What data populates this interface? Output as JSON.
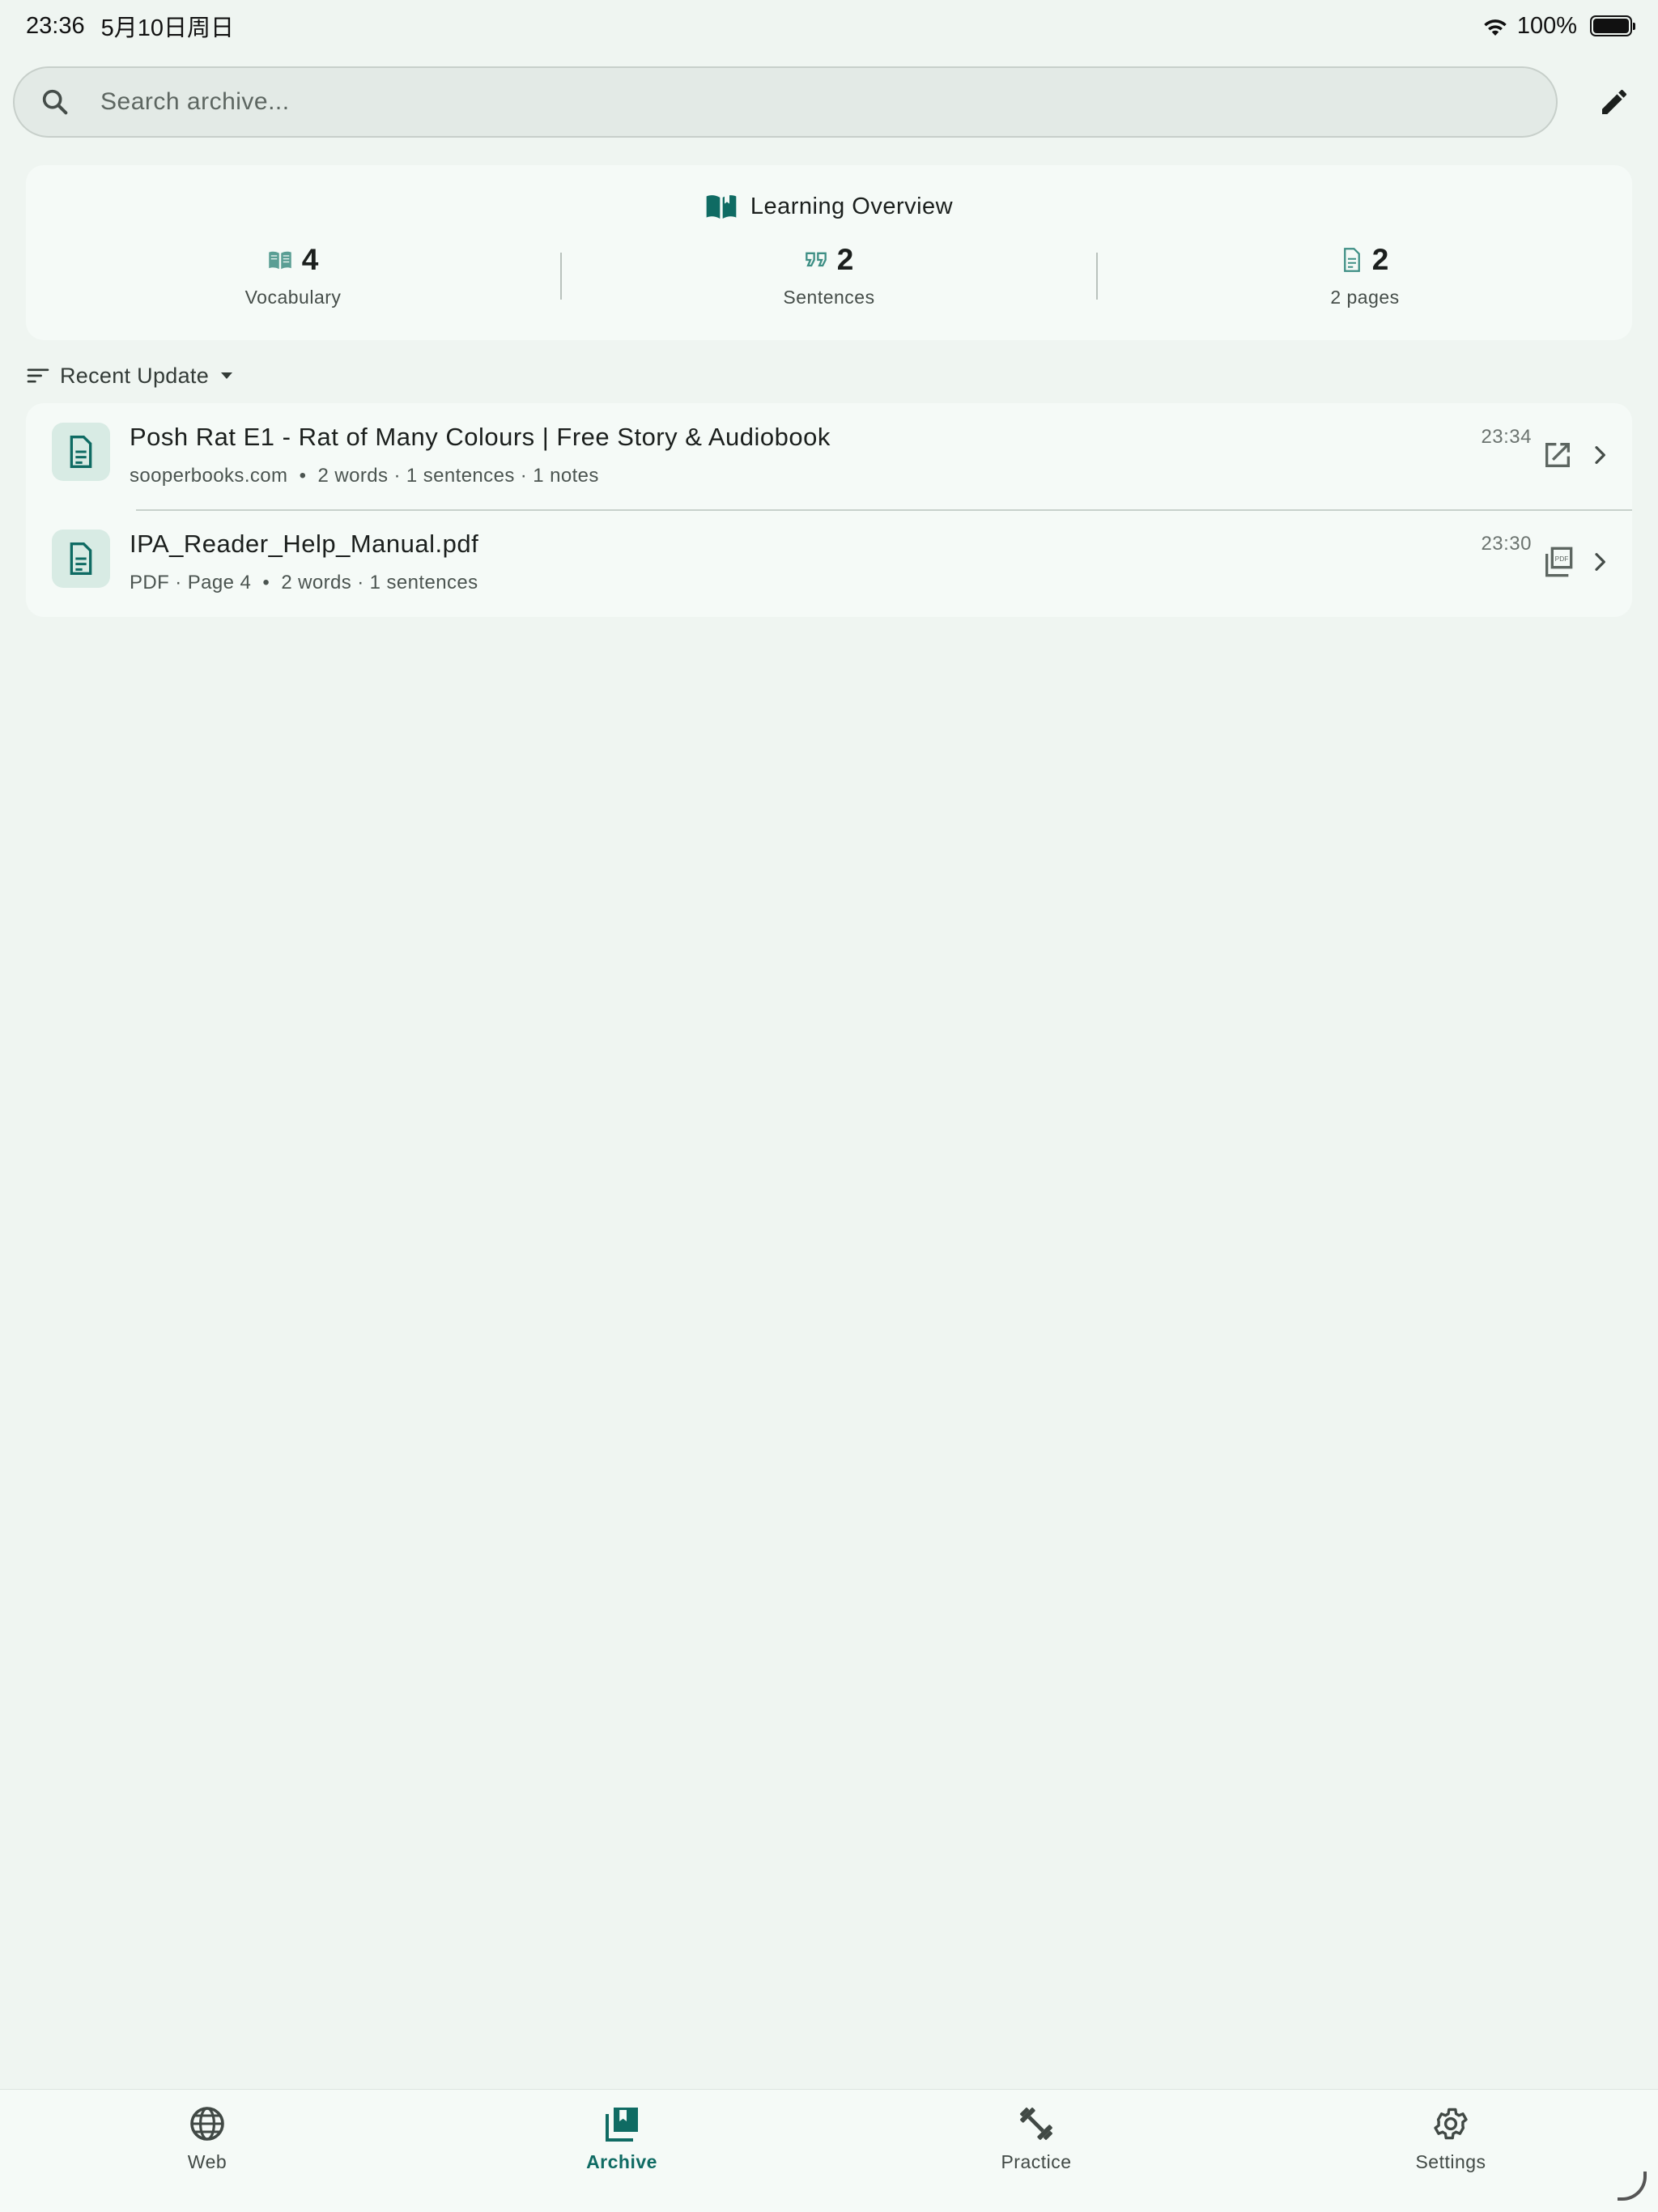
{
  "status_bar": {
    "time": "23:36",
    "date": "5月10日周日",
    "battery": "100%"
  },
  "search": {
    "placeholder": "Search archive..."
  },
  "overview": {
    "title": "Learning Overview",
    "stats": [
      {
        "value": "4",
        "label": "Vocabulary",
        "icon": "book-icon"
      },
      {
        "value": "2",
        "label": "Sentences",
        "icon": "quote-icon"
      },
      {
        "value": "2",
        "label": "2 pages",
        "icon": "document-icon"
      }
    ]
  },
  "sort": {
    "label": "Recent Update"
  },
  "items": [
    {
      "title": "Posh Rat E1 - Rat of Many Colours | Free Story & Audiobook",
      "source": "sooperbooks.com",
      "stats": "2 words · 1 sentences · 1 notes",
      "time": "23:34",
      "action_icon": "open-external-icon"
    },
    {
      "title": "IPA_Reader_Help_Manual.pdf",
      "source": "PDF · Page 4",
      "stats": "2 words · 1 sentences",
      "time": "23:30",
      "action_icon": "pdf-icon"
    }
  ],
  "nav": [
    {
      "label": "Web",
      "icon": "globe-icon",
      "active": false
    },
    {
      "label": "Archive",
      "icon": "archive-icon",
      "active": true
    },
    {
      "label": "Practice",
      "icon": "dumbbell-icon",
      "active": false
    },
    {
      "label": "Settings",
      "icon": "gear-icon",
      "active": false
    }
  ],
  "colors": {
    "accent": "#0f6b63",
    "background": "#eff5f1",
    "card": "#f5faf7"
  }
}
